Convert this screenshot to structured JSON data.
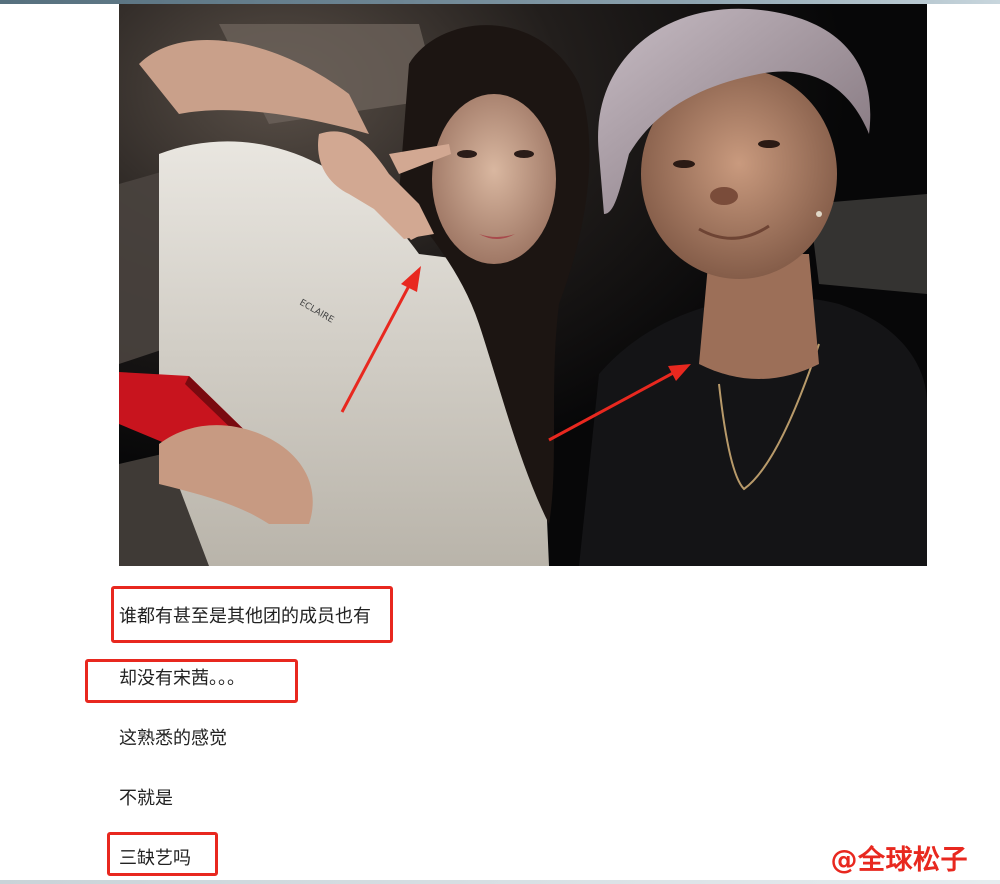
{
  "article": {
    "paragraphs": [
      "谁都有甚至是其他团的成员也有",
      "却没有宋茜。。。",
      "这熟悉的感觉",
      "不就是",
      "三缺艺吗"
    ]
  },
  "photo": {
    "shirt_print": "ECLAIRE"
  },
  "watermark": {
    "text": "@全球松子"
  },
  "colors": {
    "highlight": "#e8281f",
    "arrow": "#e8281f",
    "phone_case": "#c8141e"
  }
}
